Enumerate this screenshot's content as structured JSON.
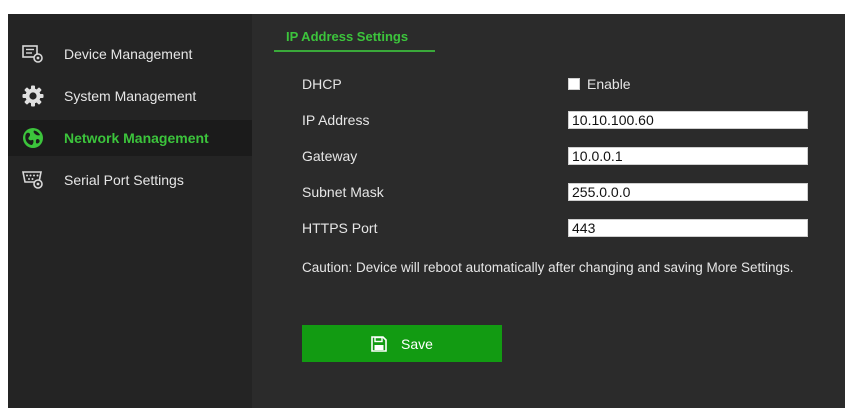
{
  "sidebar": {
    "items": [
      {
        "label": "Device Management",
        "icon": "device-management-icon"
      },
      {
        "label": "System Management",
        "icon": "gear-icon"
      },
      {
        "label": "Network Management",
        "icon": "globe-icon",
        "active": true
      },
      {
        "label": "Serial Port Settings",
        "icon": "serial-port-icon"
      }
    ]
  },
  "main": {
    "tab_label": "IP Address Settings",
    "dhcp": {
      "label": "DHCP",
      "checkbox_label": "Enable",
      "checked": false
    },
    "ip_address": {
      "label": "IP Address",
      "value": "10.10.100.60"
    },
    "gateway": {
      "label": "Gateway",
      "value": "10.0.0.1"
    },
    "subnet_mask": {
      "label": "Subnet Mask",
      "value": "255.0.0.0"
    },
    "https_port": {
      "label": "HTTPS Port",
      "value": "443"
    },
    "caution": "Caution: Device will reboot automatically after changing and saving More Settings.",
    "save_label": "Save",
    "save_icon": "floppy-disk-icon"
  },
  "colors": {
    "accent": "#3cc43c",
    "button": "#129b12",
    "panel": "#2b2b2b",
    "sidebar": "#242424"
  }
}
